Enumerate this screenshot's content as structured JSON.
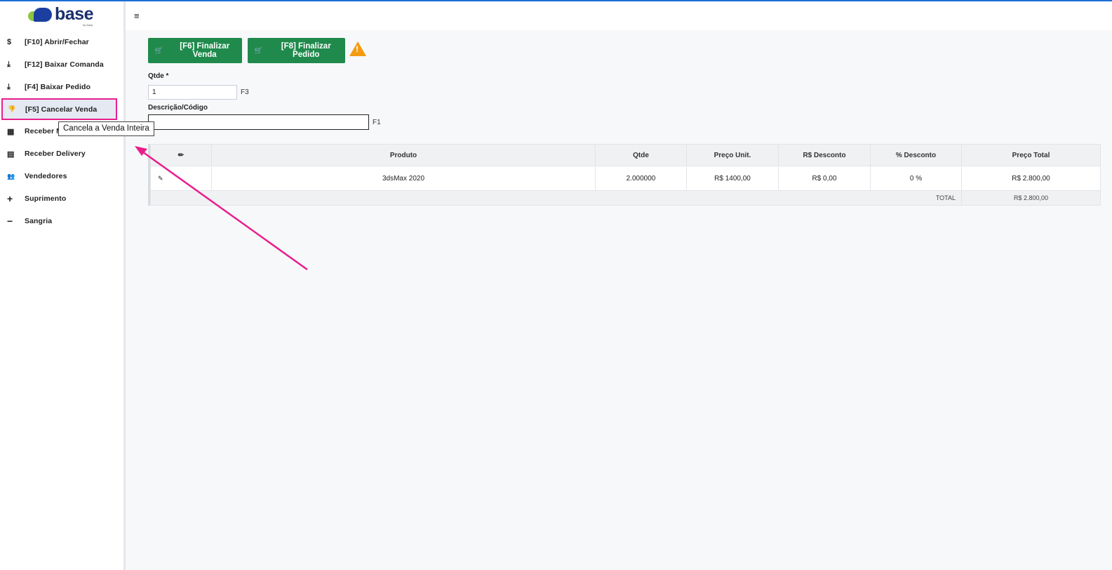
{
  "logo": {
    "brand": "base",
    "sub": "by Aasp"
  },
  "sidebar": {
    "items": [
      {
        "icon": "dollar-icon",
        "glyph": "$",
        "label": "[F10] Abrir/Fechar"
      },
      {
        "icon": "download-icon",
        "glyph": "⤓",
        "label": "[F12] Baixar Comanda"
      },
      {
        "icon": "download-icon",
        "glyph": "⤓",
        "label": "[F4] Baixar Pedido"
      },
      {
        "icon": "thumbs-down-icon",
        "glyph": "👎",
        "label": "[F5] Cancelar Venda"
      },
      {
        "icon": "grid-icon",
        "glyph": "▦",
        "label": "Receber M"
      },
      {
        "icon": "list-icon",
        "glyph": "▤",
        "label": "Receber Delivery"
      },
      {
        "icon": "users-icon",
        "glyph": "👥",
        "label": "Vendedores"
      },
      {
        "icon": "plus-icon",
        "glyph": "+",
        "label": "Suprimento"
      },
      {
        "icon": "minus-icon",
        "glyph": "−",
        "label": "Sangria"
      }
    ]
  },
  "toolbar": {
    "finalizar_venda": "[F6] Finalizar Venda",
    "finalizar_pedido": "[F8] Finalizar Pedido"
  },
  "form": {
    "qtde_label": "Qtde *",
    "qtde_value": "1",
    "qtde_hint": "F3",
    "desc_label": "Descrição/Código",
    "desc_value": "",
    "desc_hint": "F1"
  },
  "tooltip": "Cancela a Venda Inteira",
  "table": {
    "headers": [
      "",
      "Produto",
      "Qtde",
      "Preço Unit.",
      "R$ Desconto",
      "% Desconto",
      "Preço Total"
    ],
    "rows": [
      {
        "produto": "3dsMax 2020",
        "qtde": "2.000000",
        "preco_unit": "R$ 1400,00",
        "desconto_rs": "R$ 0,00",
        "desconto_pct": "0 %",
        "preco_total": "R$ 2.800,00"
      }
    ],
    "total_label": "TOTAL",
    "total_value": "R$ 2.800,00"
  },
  "colors": {
    "accent": "#1f8a4c",
    "highlight": "#e91e8c",
    "warning": "#f39c12",
    "topline": "#1c6ed4"
  }
}
